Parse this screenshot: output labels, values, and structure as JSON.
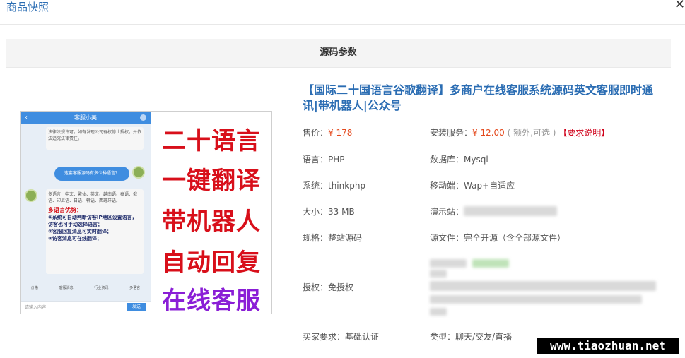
{
  "dialog": {
    "title": "商品快照",
    "close_icon": "close-icon"
  },
  "panel": {
    "heading": "源码参数"
  },
  "image": {
    "phone_header": "客服小美",
    "msg1": "法律法规许可，如有发现公司有权停止授权，并依法追究法律责任。",
    "msg_blue": "这套客服源码有多少种语言？",
    "msg2": "多语言：中文、繁体、英文、越南语、泰语、俄语、印尼语、日语、韩语、西班牙语。",
    "adv_title": "多语言优势：",
    "adv_1": "①系统可自动判断访客IP地区设置语言，访客也可手动选择语言；",
    "adv_2": "②客服回复消息可实时翻译；",
    "adv_3": "③访客消息可在线翻译；",
    "quick": [
      "价格",
      "客服消息",
      "行业资讯",
      "多语言"
    ],
    "input_placeholder": "请输入内容",
    "send": "发送",
    "promo": [
      "二十语言",
      "一键翻译",
      "带机器人",
      "自动回复",
      "在线客服"
    ]
  },
  "product": {
    "title": "【国际二十国语言谷歌翻译】多商户在线客服系统源码英文客服即时通讯|带机器人|公众号",
    "price_label": "售价：",
    "price": "¥ 178",
    "service_label": "安装服务：",
    "service_price": "¥ 12.00",
    "service_note": "( 额外,可选 )",
    "service_link": "【要求说明】",
    "language": "语言：PHP",
    "database": "数据库：Mysql",
    "system": "系统：thinkphp",
    "mobile": "移动端：Wap+自适应",
    "size": "大小：33 MB",
    "demo": "演示站：",
    "spec": "规格：整站源码",
    "source": "源文件：完全开源（含全部源文件）",
    "license": "授权：免授权",
    "buyer": "买家要求：基础认证",
    "type": "类型：聊天/交友/直播"
  },
  "watermark": "www.tiaozhuan.net"
}
